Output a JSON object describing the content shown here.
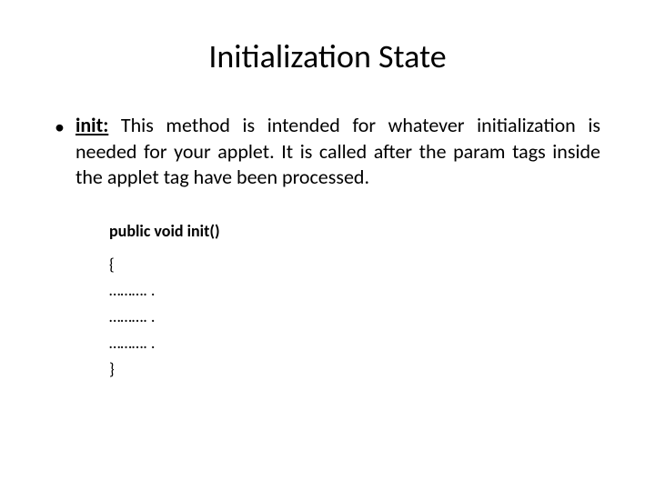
{
  "title": "Initialization State",
  "bullet": {
    "label": "init:",
    "text": "This method is intended for whatever initialization is needed for your applet. It is called after the param tags inside the applet tag have been processed."
  },
  "code": {
    "signature": "public void init()",
    "line1": "{",
    "line2": "………. .",
    "line3": "………. .",
    "line4": "………. .",
    "line5": "}"
  }
}
